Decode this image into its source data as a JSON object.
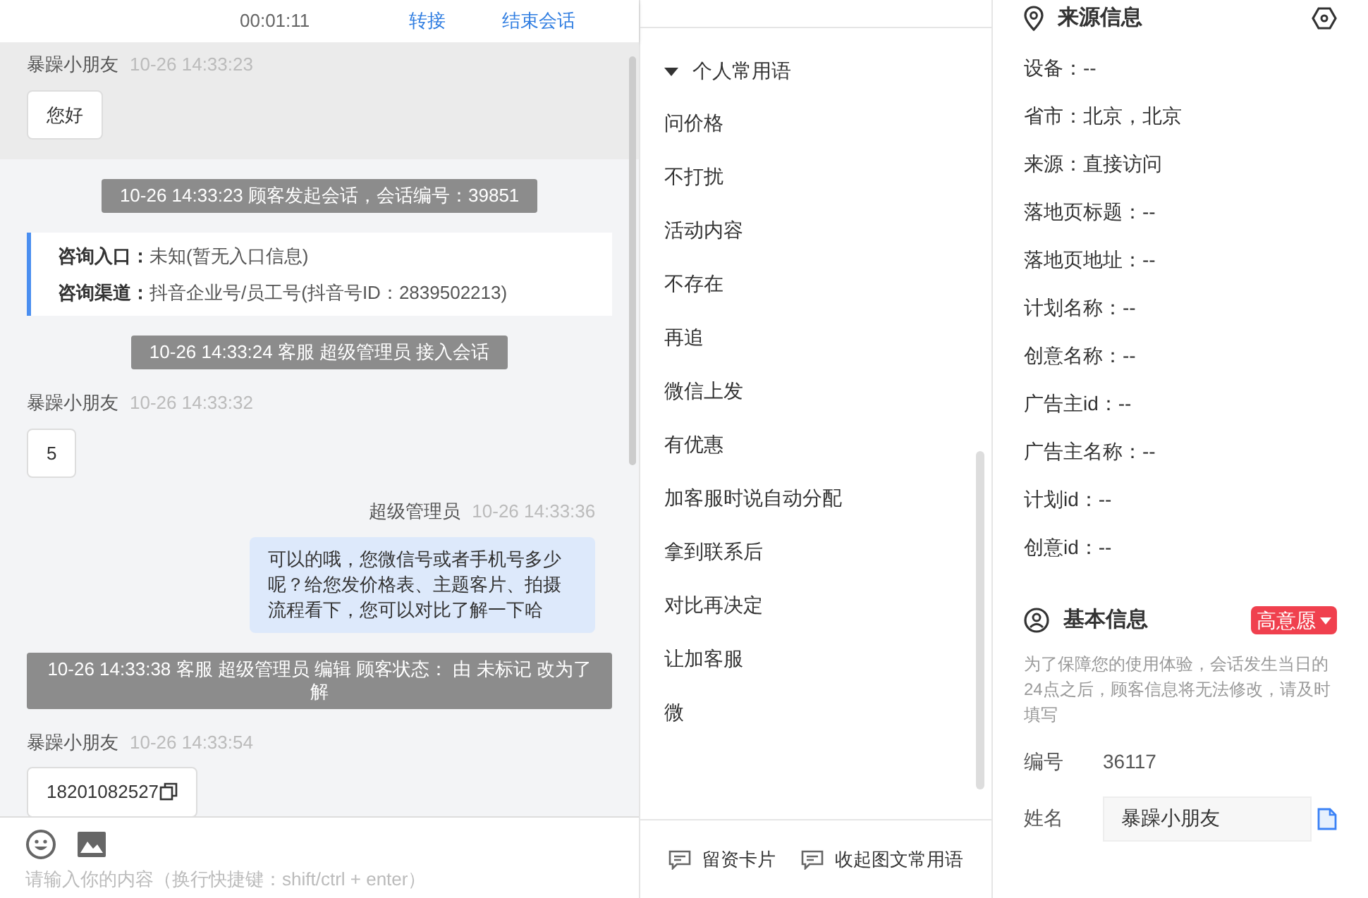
{
  "chat_header": {
    "timer": "00:01:11",
    "actions": [
      "转接",
      "结束会话"
    ]
  },
  "messages": [
    {
      "kind": "customer",
      "sender": "暴躁小朋友",
      "time": "10-26 14:33:23",
      "text": "您好",
      "highlighted": true,
      "copyable": false
    },
    {
      "kind": "system",
      "text": "10-26 14:33:23 顾客发起会话，会话编号：39851"
    },
    {
      "kind": "info",
      "lines": [
        {
          "label": "咨询入口：",
          "value": "未知(暂无入口信息)"
        },
        {
          "label": "咨询渠道：",
          "value": "抖音企业号/员工号(抖音号ID：2839502213)"
        }
      ]
    },
    {
      "kind": "system",
      "text": "10-26 14:33:24 客服 超级管理员 接入会话"
    },
    {
      "kind": "customer",
      "sender": "暴躁小朋友",
      "time": "10-26 14:33:32",
      "text": "5",
      "highlighted": false,
      "copyable": false
    },
    {
      "kind": "agent",
      "sender": "超级管理员",
      "time": "10-26 14:33:36",
      "text": "可以的哦，您微信号或者手机号多少呢？给您发价格表、主题客片、拍摄流程看下，您可以对比了解一下哈"
    },
    {
      "kind": "system",
      "text": "10-26 14:33:38 客服 超级管理员 编辑 顾客状态： 由 未标记 改为了解"
    },
    {
      "kind": "customer",
      "sender": "暴躁小朋友",
      "time": "10-26 14:33:54",
      "text": "18201082527",
      "highlighted": false,
      "copyable": true
    }
  ],
  "composer": {
    "placeholder": "请输入你的内容（换行快捷键：shift/ctrl + enter）"
  },
  "quick_replies": {
    "title": "个人常用语",
    "expanded": true,
    "items": [
      "问价格",
      "不打扰",
      "活动内容",
      "不存在",
      "再追",
      "微信上发",
      "有优惠",
      "加客服时说自动分配",
      "拿到联系后",
      "对比再决定",
      "让加客服",
      "微"
    ]
  },
  "bottom_actions": [
    "留资卡片",
    "收起图文常用语"
  ],
  "source_info": {
    "title": "来源信息",
    "fields": [
      "设备：--",
      "省市：北京，北京",
      "来源：直接访问",
      "落地页标题：--",
      "落地页地址：--",
      "计划名称：--",
      "创意名称：--",
      "广告主id：--",
      "广告主名称：--",
      "计划id：--",
      "创意id：--"
    ]
  },
  "basic_info": {
    "title": "基本信息",
    "intent_tag": "高意愿",
    "notice": "为了保障您的使用体验，会话发生当日的24点之后，顾客信息将无法修改，请及时填写",
    "fields": [
      {
        "kind": "text",
        "label": "编号",
        "value": "36117"
      },
      {
        "kind": "input",
        "label": "姓名",
        "value": "暴躁小朋友"
      }
    ]
  }
}
